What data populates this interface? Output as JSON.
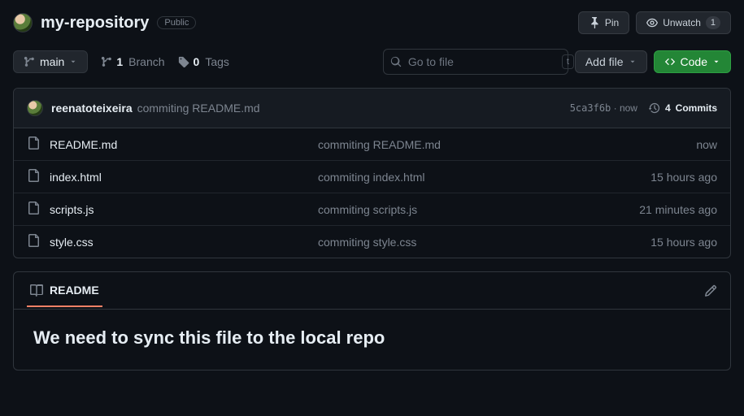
{
  "header": {
    "repo_name": "my-repository",
    "visibility": "Public",
    "pin_label": "Pin",
    "unwatch_label": "Unwatch",
    "watch_count": "1"
  },
  "toolbar": {
    "branch": "main",
    "branch_count": "1",
    "branch_word": "Branch",
    "tag_count": "0",
    "tag_word": "Tags",
    "search_placeholder": "Go to file",
    "search_kbd": "t",
    "addfile_label": "Add file",
    "code_label": "Code"
  },
  "latest_commit": {
    "author": "reenatoteixeira",
    "message": "commiting README.md",
    "sha": "5ca3f6b",
    "time": "now",
    "commit_count": "4",
    "commits_word": "Commits"
  },
  "files": [
    {
      "name": "README.md",
      "msg": "commiting README.md",
      "time": "now"
    },
    {
      "name": "index.html",
      "msg": "commiting index.html",
      "time": "15 hours ago"
    },
    {
      "name": "scripts.js",
      "msg": "commiting scripts.js",
      "time": "21 minutes ago"
    },
    {
      "name": "style.css",
      "msg": "commiting style.css",
      "time": "15 hours ago"
    }
  ],
  "readme": {
    "tab_label": "README",
    "heading": "We need to sync this file to the local repo"
  }
}
